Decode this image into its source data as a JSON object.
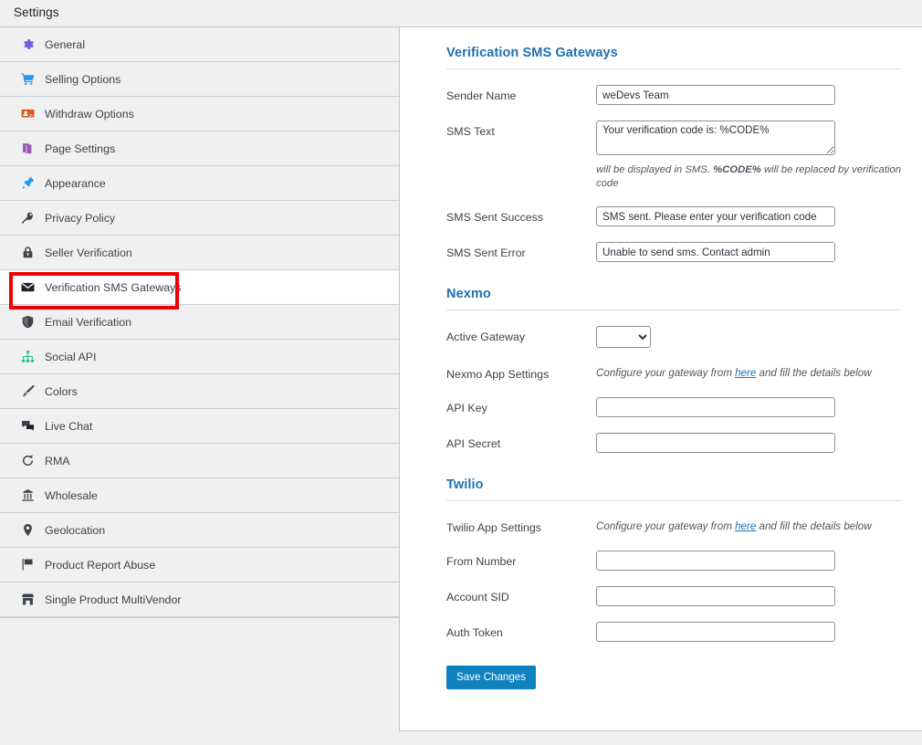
{
  "header": {
    "title": "Settings"
  },
  "sidebar": {
    "items": [
      {
        "label": "General",
        "icon": "gear-icon",
        "active": false
      },
      {
        "label": "Selling Options",
        "icon": "cart-icon",
        "active": false
      },
      {
        "label": "Withdraw Options",
        "icon": "withdraw-icon",
        "active": false
      },
      {
        "label": "Page Settings",
        "icon": "pages-icon",
        "active": false
      },
      {
        "label": "Appearance",
        "icon": "pin-icon",
        "active": false
      },
      {
        "label": "Privacy Policy",
        "icon": "key-icon",
        "active": false
      },
      {
        "label": "Seller Verification",
        "icon": "lock-icon",
        "active": false
      },
      {
        "label": "Verification SMS Gateways",
        "icon": "envelope-icon",
        "active": true
      },
      {
        "label": "Email Verification",
        "icon": "shield-icon",
        "active": false
      },
      {
        "label": "Social API",
        "icon": "sitemap-icon",
        "active": false
      },
      {
        "label": "Colors",
        "icon": "brush-icon",
        "active": false
      },
      {
        "label": "Live Chat",
        "icon": "chat-icon",
        "active": false
      },
      {
        "label": "RMA",
        "icon": "refresh-icon",
        "active": false
      },
      {
        "label": "Wholesale",
        "icon": "wholesale-icon",
        "active": false
      },
      {
        "label": "Geolocation",
        "icon": "map-pin-icon",
        "active": false
      },
      {
        "label": "Product Report Abuse",
        "icon": "flag-icon",
        "active": false
      },
      {
        "label": "Single Product MultiVendor",
        "icon": "store-icon",
        "active": false
      }
    ]
  },
  "main": {
    "sms_gateways": {
      "title": "Verification SMS Gateways",
      "sender_name": {
        "label": "Sender Name",
        "value": "weDevs Team",
        "placeholder": ""
      },
      "sms_text": {
        "label": "SMS Text",
        "value": "Your verification code is: %CODE%",
        "placeholder": "",
        "hint_before": "will be displayed in SMS. ",
        "hint_code": "%CODE%",
        "hint_after": " will be replaced by verification code"
      },
      "sms_sent_success": {
        "label": "SMS Sent Success",
        "value": "SMS sent. Please enter your verification code",
        "placeholder": ""
      },
      "sms_sent_error": {
        "label": "SMS Sent Error",
        "value": "Unable to send sms. Contact admin",
        "placeholder": ""
      }
    },
    "nexmo": {
      "title": "Nexmo",
      "active_gateway": {
        "label": "Active Gateway",
        "value": "",
        "options": [
          ""
        ]
      },
      "app_settings": {
        "label": "Nexmo App Settings",
        "desc_before": "Configure your gateway from ",
        "desc_link": "here",
        "desc_after": " and fill the details below"
      },
      "api_key": {
        "label": "API Key",
        "value": "",
        "placeholder": ""
      },
      "api_secret": {
        "label": "API Secret",
        "value": "",
        "placeholder": ""
      }
    },
    "twilio": {
      "title": "Twilio",
      "app_settings": {
        "label": "Twilio App Settings",
        "desc_before": "Configure your gateway from ",
        "desc_link": "here",
        "desc_after": " and fill the details below"
      },
      "from_number": {
        "label": "From Number",
        "value": "",
        "placeholder": ""
      },
      "account_sid": {
        "label": "Account SID",
        "value": "",
        "placeholder": ""
      },
      "auth_token": {
        "label": "Auth Token",
        "value": "",
        "placeholder": ""
      }
    },
    "save": {
      "label": "Save Changes"
    }
  },
  "annotation": {
    "highlight_target": "Verification SMS Gateways",
    "color": "#ee0000"
  },
  "colors": {
    "accent": "#2271b1",
    "button": "#0f81bc",
    "sidebar_bg": "#f0f0f1",
    "divider": "#c8d0d6",
    "highlight": "#ee0000"
  }
}
